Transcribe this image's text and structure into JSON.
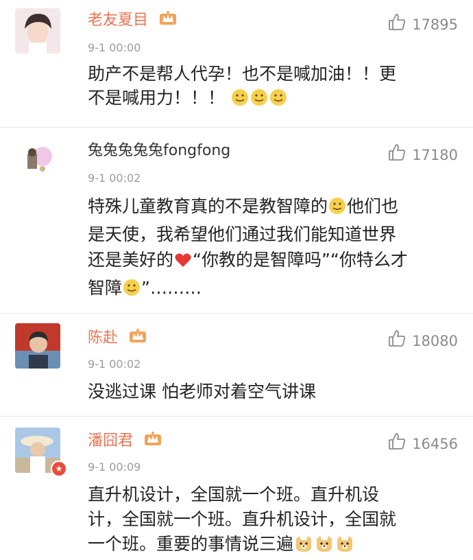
{
  "comments": [
    {
      "user": "老友夏目",
      "time": "9-1 00:00",
      "likes": "17895",
      "vip": true,
      "text": [
        "助产不是帮人代孕！也不是喊加油！！更",
        "不是喊用力！！！"
      ],
      "emoji": [
        "face-emoji",
        "face-emoji",
        "face-emoji"
      ]
    },
    {
      "user": "兔兔兔兔兔fongfong",
      "time": "9-1 00:02",
      "likes": "17180",
      "vip": false,
      "text_segments": [
        "特殊儿童教育真的不是教智障的",
        "他们也",
        "是天使，我希望他们通过我们能知道世界",
        "还是美好的",
        "“你教的是智障吗”“你特么才",
        "智障",
        "”………"
      ]
    },
    {
      "user": "陈赴",
      "time": "9-1 00:02",
      "likes": "18080",
      "vip": true,
      "text": [
        "没逃过课 怕老师对着空气讲课"
      ]
    },
    {
      "user": "潘囧君",
      "time": "9-1 00:09",
      "likes": "16456",
      "vip": true,
      "text": [
        "直升机设计，全国就一个班。直升机设",
        "计，全国就一个班。直升机设计，全国就",
        "一个班。重要的事情说三遍"
      ]
    }
  ],
  "icons": {
    "like": "thumbs-up-icon",
    "crown": "vip-crown-icon",
    "heart": "heart-emoji",
    "smile": "smile-emoji",
    "dog": "dog-emoji"
  },
  "colors": {
    "vip_name": "#eb7350",
    "divider": "#e6e6e6",
    "time": "#9b9b9b",
    "like": "#8a8a8a"
  }
}
